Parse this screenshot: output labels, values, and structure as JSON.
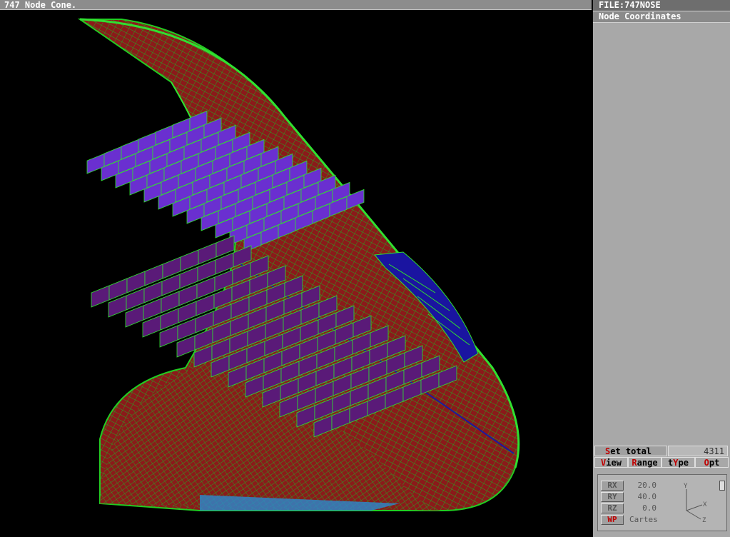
{
  "window": {
    "title": "747 Node Cone."
  },
  "panel": {
    "file": "FILE:747NOSE",
    "mode": "Node Coordinates",
    "set_total": {
      "hot": "S",
      "rest": "et total",
      "value": "4311"
    },
    "menu": [
      {
        "pre": "",
        "hot": "V",
        "post": "iew"
      },
      {
        "pre": "",
        "hot": "R",
        "post": "ange"
      },
      {
        "pre": "t",
        "hot": "Y",
        "post": "pe"
      },
      {
        "pre": "",
        "hot": "O",
        "post": "pt"
      }
    ],
    "rotation": {
      "rx": {
        "label": "RX",
        "value": "20.0"
      },
      "ry": {
        "label": "RY",
        "value": "40.0"
      },
      "rz": {
        "label": "RZ",
        "value": "0.0"
      },
      "wp": {
        "label": "WP",
        "value": "Cartes"
      }
    },
    "axes": {
      "y": "Y",
      "x": "X",
      "z": "Z"
    }
  },
  "colors": {
    "skin": "#8b1a1a",
    "mesh": "#22bb22",
    "panel_upper": "#6a2fd0",
    "panel_lower": "#5a1a78",
    "panel_blue": "#1a14a0",
    "cyan": "#2a8ad0"
  },
  "icons": {
    "pin": "pin-icon"
  }
}
